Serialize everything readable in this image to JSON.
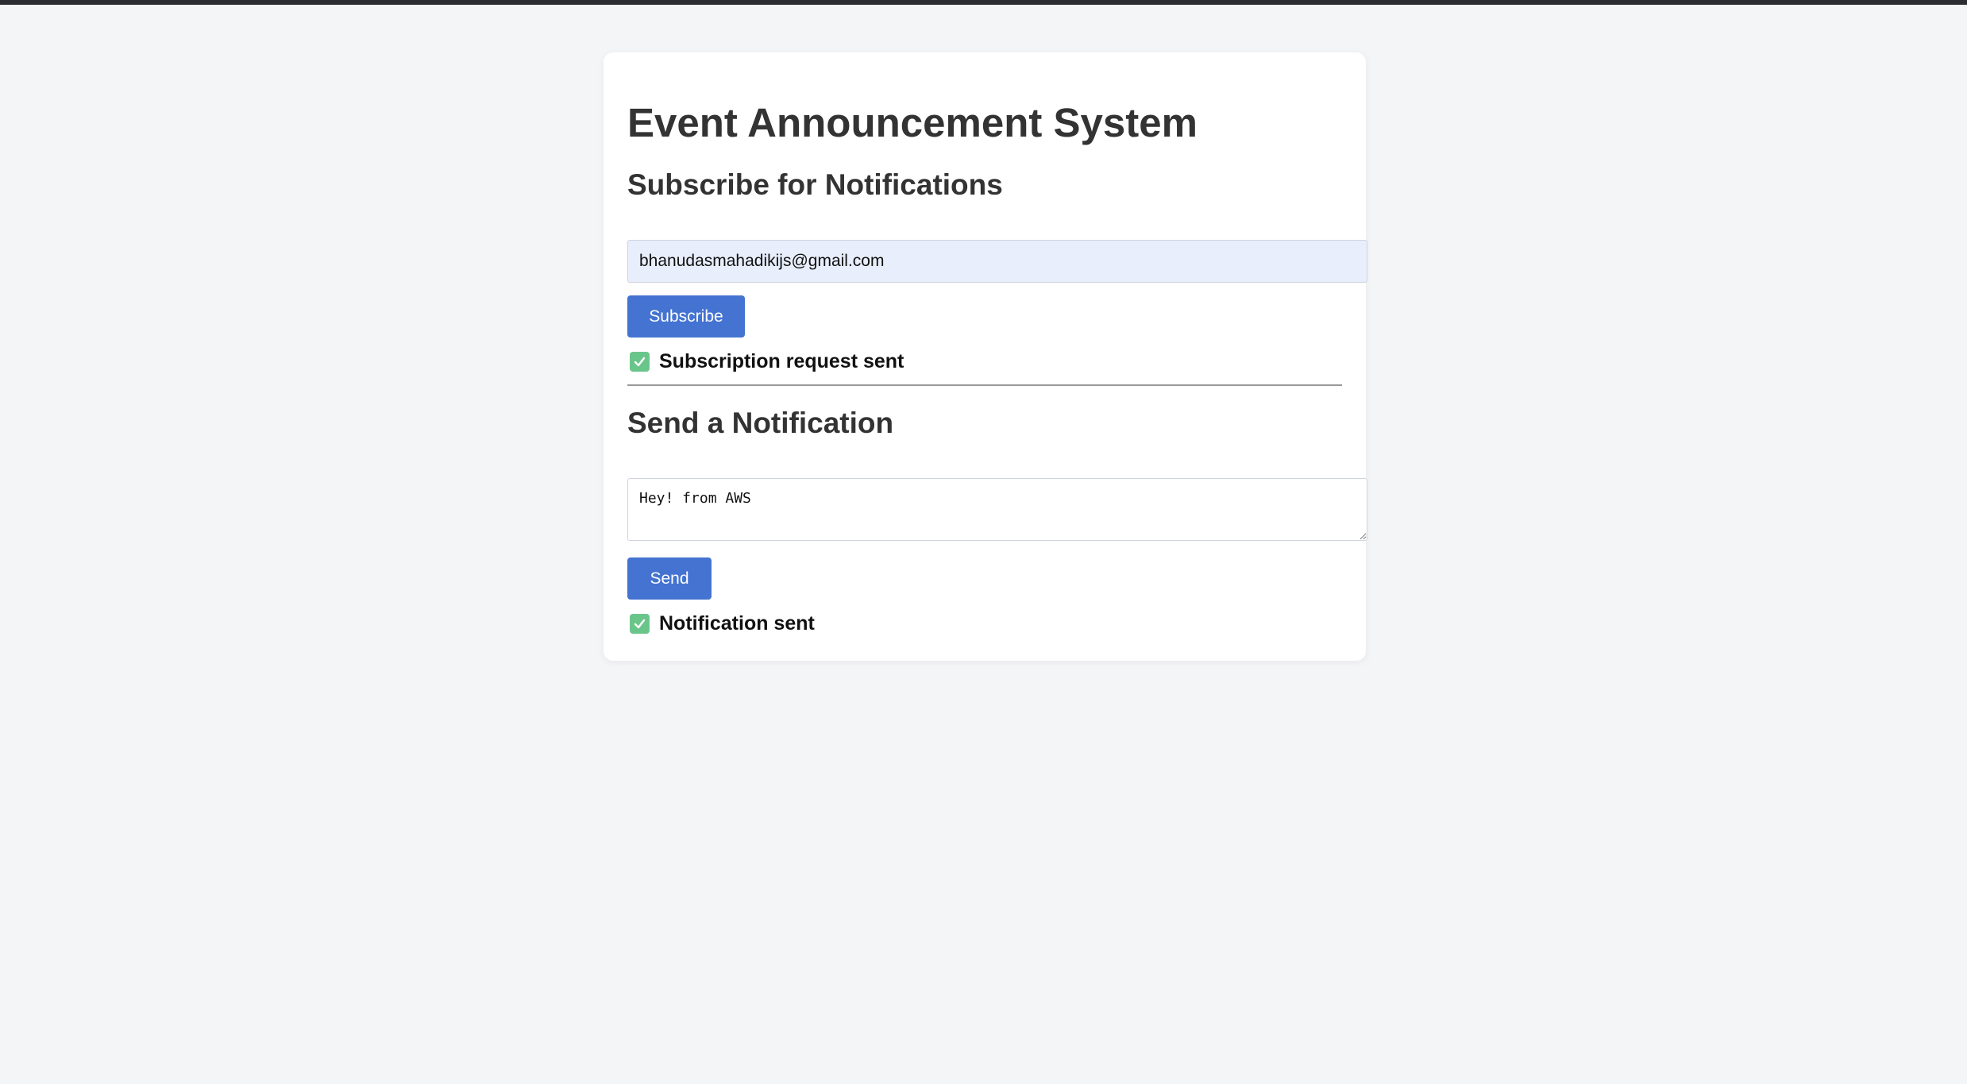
{
  "app": {
    "title": "Event Announcement System"
  },
  "subscribe": {
    "heading": "Subscribe for Notifications",
    "email_value": "bhanudasmahadikijs@gmail.com",
    "button_label": "Subscribe",
    "status_icon": "check-icon",
    "status_text": "Subscription request sent"
  },
  "notify": {
    "heading": "Send a Notification",
    "message_value": "Hey! from AWS",
    "button_label": "Send",
    "status_icon": "check-icon",
    "status_text": "Notification sent"
  },
  "colors": {
    "background": "#f4f5f7",
    "card": "#ffffff",
    "button": "#4473d1",
    "email_field_fill": "#e8eefb",
    "status_check": "#6ac58b"
  }
}
